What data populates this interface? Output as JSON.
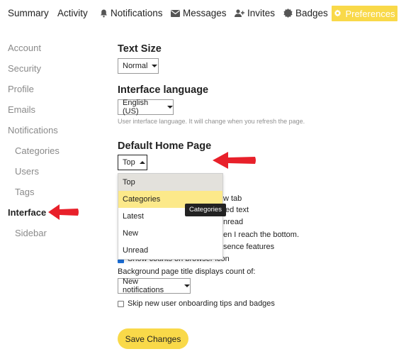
{
  "topnav": {
    "items": [
      {
        "label": "Summary",
        "icon": ""
      },
      {
        "label": "Activity",
        "icon": ""
      },
      {
        "label": "Notifications",
        "icon": "bell-icon"
      },
      {
        "label": "Messages",
        "icon": "envelope-icon"
      },
      {
        "label": "Invites",
        "icon": "user-plus-icon"
      },
      {
        "label": "Badges",
        "icon": "badge-icon"
      }
    ],
    "active": {
      "label": "Preferences",
      "icon": "gear-icon"
    }
  },
  "sidebar": {
    "items": [
      {
        "label": "Account"
      },
      {
        "label": "Security"
      },
      {
        "label": "Profile"
      },
      {
        "label": "Emails"
      },
      {
        "label": "Notifications"
      },
      {
        "label": "Categories"
      },
      {
        "label": "Users"
      },
      {
        "label": "Tags"
      },
      {
        "label": "Interface"
      },
      {
        "label": "Sidebar"
      }
    ],
    "active_item": "Interface"
  },
  "text_size": {
    "heading": "Text Size",
    "value": "Normal"
  },
  "interface_language": {
    "heading": "Interface language",
    "value": "English (US)",
    "hint": "User interface language. It will change when you refresh the page."
  },
  "default_home_page": {
    "heading": "Default Home Page",
    "value": "Top",
    "options": [
      "Top",
      "Categories",
      "Latest",
      "New",
      "Unread"
    ],
    "tooltip": "Categories"
  },
  "options_partial": {
    "open_new_tab": "w tab",
    "quoted_text": "ted text",
    "unread": "nread",
    "reach_bottom": "en I reach the bottom.",
    "presence": "sence features",
    "browser_icon": "Show counts on browser icon"
  },
  "background_title": {
    "label": "Background page title displays count of:",
    "value": "New notifications"
  },
  "skip_onboarding": {
    "label": "Skip new user onboarding tips and badges",
    "checked": false
  },
  "save_label": "Save Changes",
  "colors": {
    "accent": "#f9d949",
    "highlight": "#fce98a",
    "annotation_arrow": "#e8202a",
    "checkbox_blue": "#1b6fd8"
  }
}
